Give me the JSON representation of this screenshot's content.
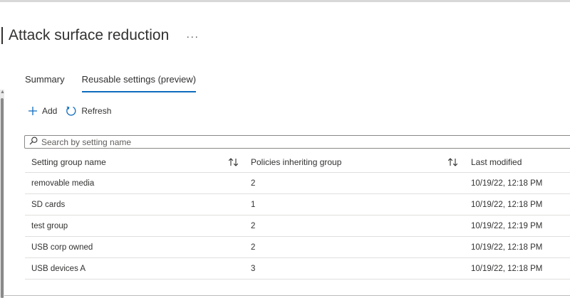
{
  "page": {
    "title": "Attack surface reduction",
    "more_label": "···"
  },
  "tabs": [
    {
      "label": "Summary",
      "active": false
    },
    {
      "label": "Reusable settings (preview)",
      "active": true
    }
  ],
  "toolbar": {
    "add_label": "Add",
    "add_icon": "plus-icon",
    "refresh_label": "Refresh",
    "refresh_icon": "refresh-icon"
  },
  "search": {
    "placeholder": "Search by setting name",
    "value": "",
    "icon": "search-icon"
  },
  "table": {
    "columns": [
      {
        "label": "Setting group name",
        "sortable": true
      },
      {
        "label": "Policies inheriting group",
        "sortable": true
      },
      {
        "label": "Last modified",
        "sortable": false
      }
    ],
    "rows": [
      {
        "name": "removable media",
        "policies": "2",
        "modified": "10/19/22, 12:18 PM"
      },
      {
        "name": "SD cards",
        "policies": "1",
        "modified": "10/19/22, 12:18 PM"
      },
      {
        "name": "test group",
        "policies": "2",
        "modified": "10/19/22, 12:19 PM"
      },
      {
        "name": "USB corp owned",
        "policies": "2",
        "modified": "10/19/22, 12:18 PM"
      },
      {
        "name": "USB devices A",
        "policies": "3",
        "modified": "10/19/22, 12:18 PM"
      }
    ]
  },
  "colors": {
    "accent": "#0f6cbd",
    "text": "#323130",
    "border": "#e1dfdd"
  }
}
